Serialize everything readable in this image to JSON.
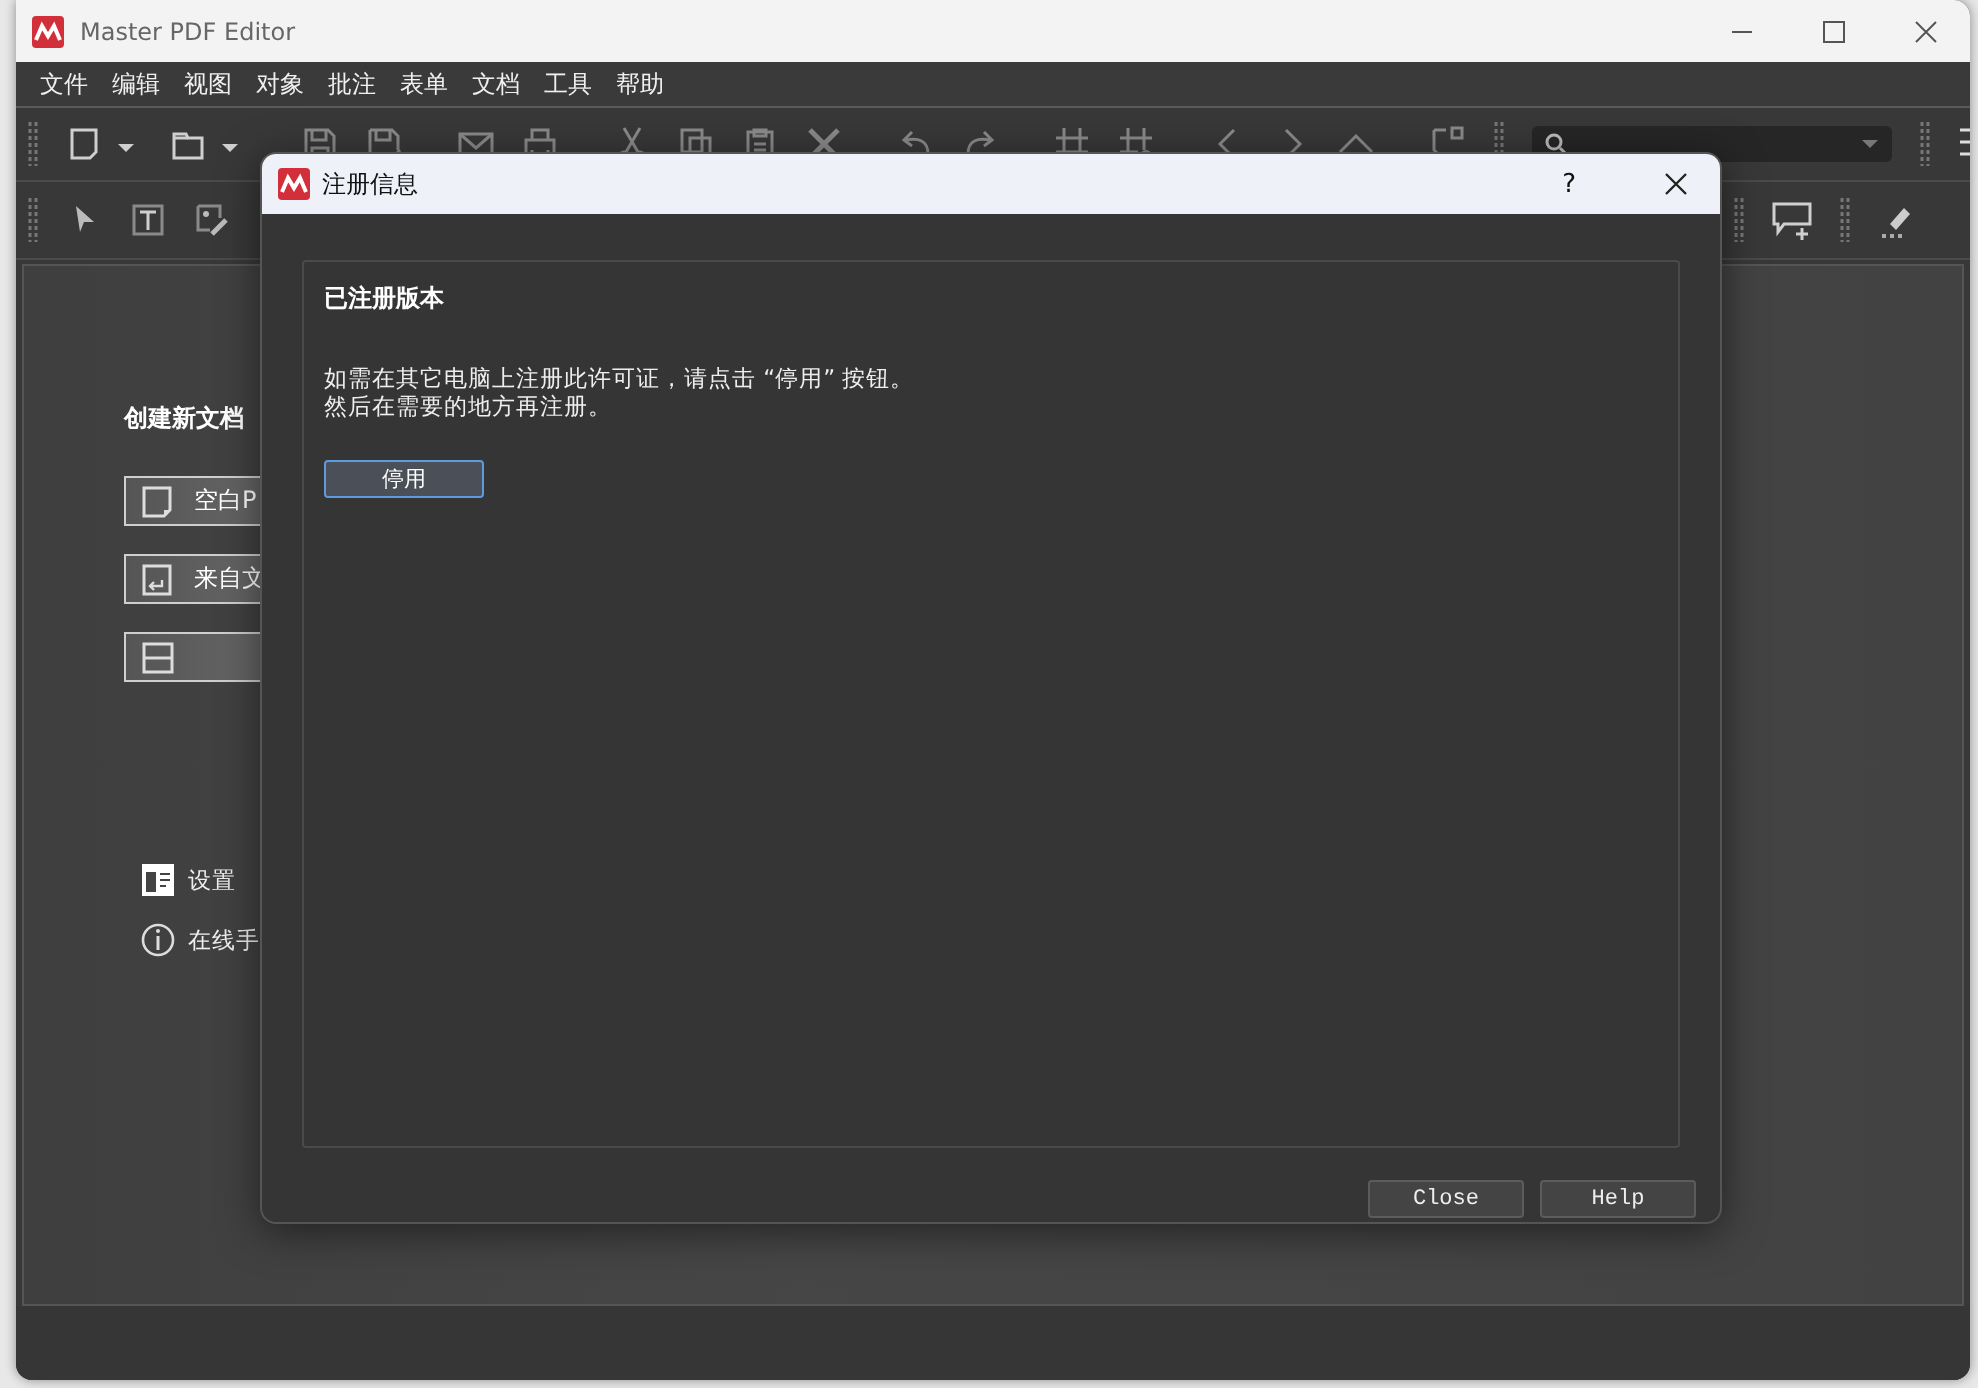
{
  "window": {
    "title": "Master PDF Editor"
  },
  "menu": [
    "文件",
    "编辑",
    "视图",
    "对象",
    "批注",
    "表单",
    "文档",
    "工具",
    "帮助"
  ],
  "start_panel": {
    "heading": "创建新文档",
    "buttons": [
      {
        "kind": "blank",
        "label": "空白P"
      },
      {
        "kind": "file",
        "label": "来自文"
      },
      {
        "kind": "scan"
      }
    ],
    "links": [
      {
        "kind": "settings",
        "label": "设置"
      },
      {
        "kind": "help",
        "label": "在线手"
      }
    ]
  },
  "dialog": {
    "title": "注册信息",
    "help_glyph": "?",
    "group_title": "已注册版本",
    "message": [
      "如需在其它电脑上注册此许可证，请点击 “停用” 按钮。",
      "然后在需要的地方再注册。"
    ],
    "deactivate_button": {
      "label": "停用",
      "focused": true
    },
    "buttons": [
      "Close",
      "Help"
    ]
  }
}
